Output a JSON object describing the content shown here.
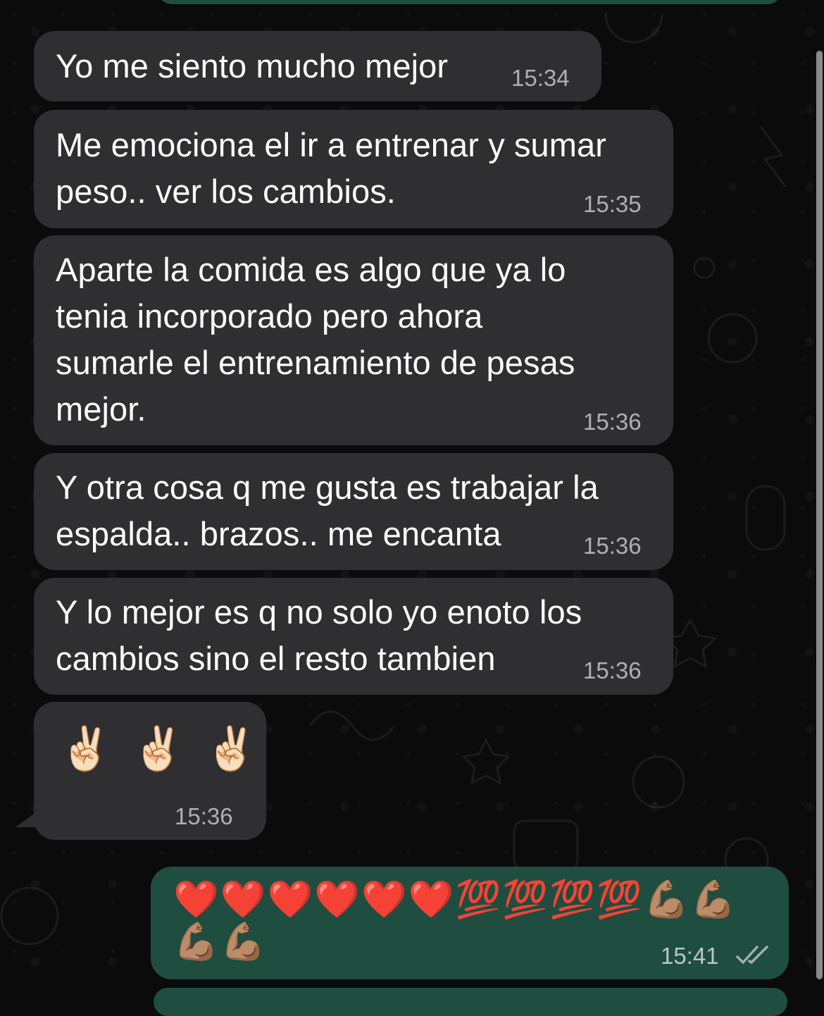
{
  "chat": {
    "messages": [
      {
        "text": "Yo me siento mucho mejor",
        "time": "15:34"
      },
      {
        "text": "Me emociona el ir a entrenar y sumar\npeso.. ver los cambios.",
        "time": "15:35"
      },
      {
        "text": "Aparte la comida es algo que ya lo\ntenia incorporado pero ahora\nsumarle el entrenamiento de pesas\nmejor.",
        "time": "15:36"
      },
      {
        "text": "Y otra cosa q me gusta es trabajar la\nespalda.. brazos.. me encanta",
        "time": "15:36"
      },
      {
        "text": "Y lo mejor es q no solo yo enoto los\ncambios sino el resto tambien",
        "time": "15:36"
      },
      {
        "text": "✌🏻 ✌🏻 ✌🏻",
        "time": "15:36"
      }
    ],
    "outgoing": {
      "line1": "❤️❤️❤️❤️❤️❤️💯💯💯💯💪🏽💪🏽",
      "line2": "💪🏽💪🏽",
      "time": "15:41",
      "status_icon": "double-check-icon"
    }
  },
  "colors": {
    "background": "#0b0b0b",
    "incoming_bubble": "#2f2f31",
    "outgoing_bubble": "#1f4d3f",
    "timestamp": "#b0b0b0"
  }
}
